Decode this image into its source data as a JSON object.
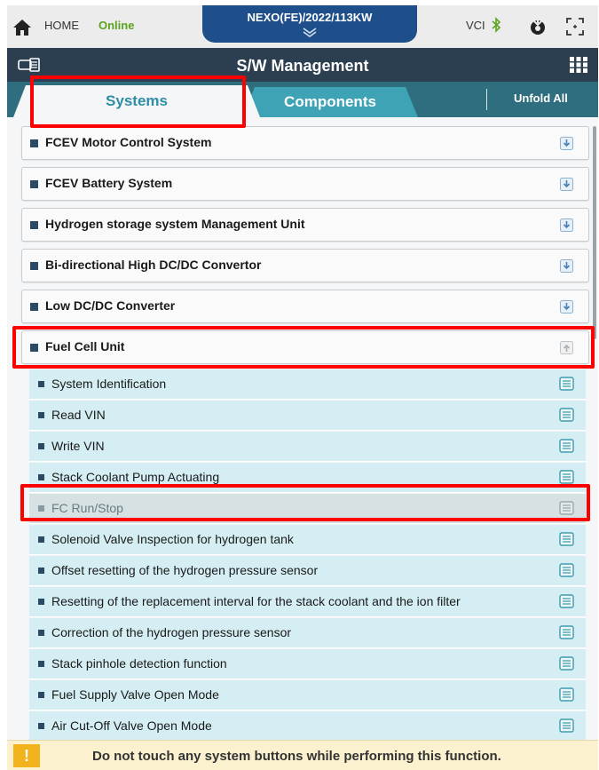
{
  "topbar": {
    "home_label": "HOME",
    "status": "Online",
    "vehicle": "NEXO(FE)/2022/113KW",
    "vci_label": "VCI"
  },
  "header": {
    "title": "S/W Management"
  },
  "tabs": {
    "systems": "Systems",
    "components": "Components",
    "unfold_all": "Unfold All"
  },
  "systems": [
    {
      "label": "FCEV Motor Control System"
    },
    {
      "label": "FCEV Battery System"
    },
    {
      "label": "Hydrogen storage system Management Unit"
    },
    {
      "label": "Bi-directional High DC/DC Convertor"
    },
    {
      "label": "Low DC/DC Converter"
    },
    {
      "label": "Fuel Cell Unit"
    }
  ],
  "functions": [
    {
      "label": "System Identification"
    },
    {
      "label": "Read VIN"
    },
    {
      "label": "Write VIN"
    },
    {
      "label": "Stack Coolant Pump Actuating"
    },
    {
      "label": "FC Run/Stop"
    },
    {
      "label": "Solenoid Valve Inspection for hydrogen tank"
    },
    {
      "label": "Offset resetting of the hydrogen pressure sensor"
    },
    {
      "label": "Resetting of the replacement interval for the stack coolant and the ion filter"
    },
    {
      "label": "Correction of the hydrogen pressure sensor"
    },
    {
      "label": "Stack pinhole detection function"
    },
    {
      "label": "Fuel Supply Valve Open Mode"
    },
    {
      "label": "Air Cut-Off Valve Open Mode"
    }
  ],
  "footer": {
    "warning_symbol": "!",
    "message": "Do not touch any system buttons while performing this function."
  },
  "colors": {
    "header_bg": "#2c3f50",
    "tab_row_bg": "#2f6e7e",
    "tab_active_text": "#2e8fa4",
    "vehicle_tab_bg": "#1f4f8a",
    "status_online": "#5aa41c",
    "function_row_bg": "#d4eef3",
    "highlight": "#ff0000",
    "warning": "#f2b21b"
  }
}
